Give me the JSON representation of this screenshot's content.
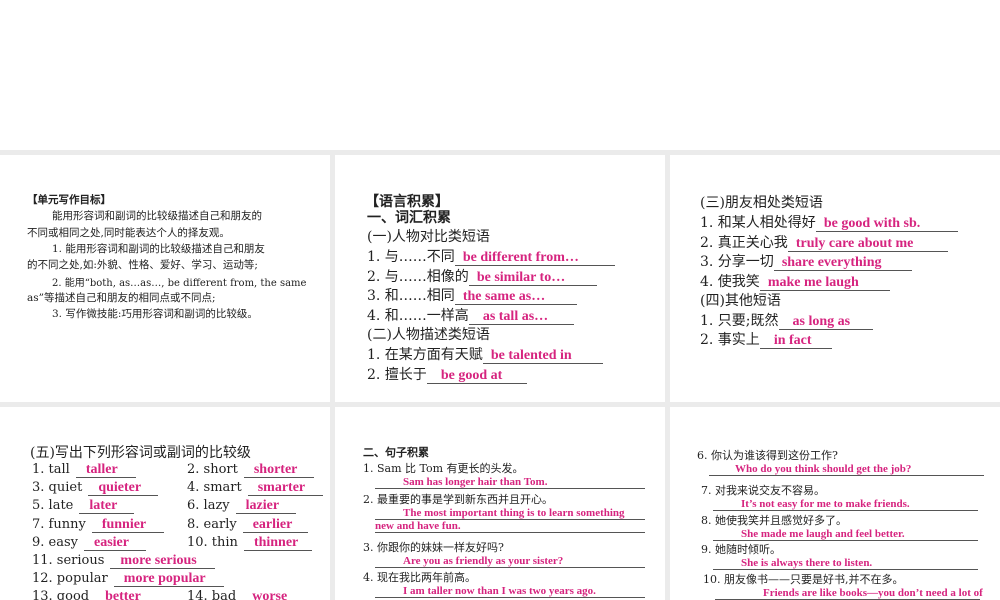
{
  "goals": {
    "title": "【单元写作目标】",
    "intro1": "能用形容词和副词的比较级描述自己和朋友的",
    "intro2": "不同或相同之处,同时能表达个人的择友观。",
    "g1a": "1. 能用形容词和副词的比较级描述自己和朋友",
    "g1b": "的不同之处,如:外貌、性格、爱好、学习、运动等;",
    "g2a": "2. 能用“both, as…as…, be different from, the same",
    "g2b": "as”等描述自己和朋友的相同点或不同点;",
    "g3": "3. 写作微技能:巧用形容词和副词的比较级。"
  },
  "vocab": {
    "title": "【语言积累】",
    "section": "一、词汇积累",
    "sub1": "(一)人物对比类短语",
    "items1": [
      {
        "q": "1. 与……不同",
        "a": "be different from…"
      },
      {
        "q": "2. 与……相像的",
        "a": "be similar to…"
      },
      {
        "q": "3. 和……相同",
        "a": "the same as…"
      },
      {
        "q": "4. 和……一样高",
        "a": "as tall as…"
      }
    ],
    "sub2": "(二)人物描述类短语",
    "items2": [
      {
        "q": "1. 在某方面有天赋",
        "a": "be talented in"
      },
      {
        "q": "2. 擅长于",
        "a": "be good at"
      }
    ],
    "sub3": "(三)朋友相处类短语",
    "items3": [
      {
        "q": "1. 和某人相处得好",
        "a": "be good with sb."
      },
      {
        "q": "2. 真正关心我",
        "a": "truly care about me"
      },
      {
        "q": "3. 分享一切",
        "a": "share everything"
      },
      {
        "q": "4. 使我笑",
        "a": "make me laugh"
      }
    ],
    "sub4": "(四)其他短语",
    "items4": [
      {
        "q": "1. 只要;既然",
        "a": "as long as"
      },
      {
        "q": "2. 事实上",
        "a": "in fact"
      }
    ]
  },
  "compare": {
    "title": "(五)写出下列形容词或副词的比较级",
    "items": [
      {
        "q": "1. tall",
        "a": "taller"
      },
      {
        "q": "2. short",
        "a": "shorter"
      },
      {
        "q": "3. quiet",
        "a": "quieter"
      },
      {
        "q": "4. smart",
        "a": "smarter"
      },
      {
        "q": "5. late",
        "a": "later"
      },
      {
        "q": "6. lazy",
        "a": "lazier"
      },
      {
        "q": "7. funny",
        "a": "funnier"
      },
      {
        "q": "8. early",
        "a": "earlier"
      },
      {
        "q": "9. easy",
        "a": "easier"
      },
      {
        "q": "10. thin",
        "a": "thinner"
      },
      {
        "q": "11. serious",
        "a": "more serious"
      },
      {
        "q": "12. popular",
        "a": "more popular"
      },
      {
        "q": "13. good",
        "a": "better"
      },
      {
        "q": "14. bad",
        "a": "worse"
      }
    ]
  },
  "sentences": {
    "title": "二、句子积累",
    "items": [
      {
        "q": "1. Sam 比 Tom 有更长的头发。",
        "a": "Sam has longer hair than Tom."
      },
      {
        "q": "2. 最重要的事是学到新东西并且开心。",
        "a": "The most important thing is to learn something",
        "a2": "new and have fun."
      },
      {
        "q": "3. 你跟你的妹妹一样友好吗?",
        "a": "Are you as friendly as your sister?"
      },
      {
        "q": "4. 现在我比两年前高。",
        "a": "I am taller now than I was two years ago."
      },
      {
        "q": "6. 你认为谁该得到这份工作?",
        "a": "Who do you think should get the job?"
      },
      {
        "q": "7. 对我来说交友不容易。",
        "a": "It’s not easy for me to make friends."
      },
      {
        "q": "8. 她使我笑并且感觉好多了。",
        "a": "She made me laugh and feel better."
      },
      {
        "q": "9. 她随时倾听。",
        "a": "She is always there to listen."
      },
      {
        "q": "10. 朋友像书——只要是好书,并不在多。",
        "a": "Friends are like books—you don’t need a lot of"
      }
    ]
  }
}
